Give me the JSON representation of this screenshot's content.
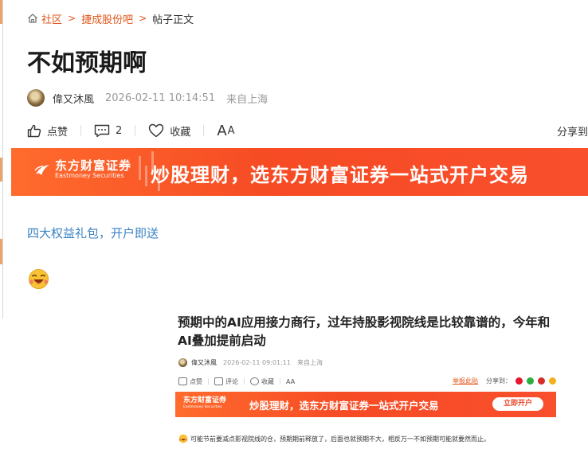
{
  "breadcrumb": {
    "home": "社区",
    "forum": "捷成股份吧",
    "current": "帖子正文",
    "separator": ">"
  },
  "post": {
    "title": "不如预期啊",
    "author": "偉又沐風",
    "time": "2026-02-11 10:14:51",
    "location": "来自上海"
  },
  "actions": {
    "like": "点赞",
    "comment_count": "2",
    "favorite": "收藏",
    "font_size_large": "A",
    "font_size_small": "A",
    "share": "分享到"
  },
  "banner": {
    "logo_cn": "东方财富证券",
    "logo_en": "Eastmoney Securities",
    "slogan": "炒股理财，选东方财富证券一站式开户交易"
  },
  "promo_link": "四大权益礼包，开户即送",
  "embedded": {
    "title": "预期中的AI应用接力商行，过年持股影视院线是比较靠谱的，今年和AI叠加提前启动",
    "author": "偉又沐風",
    "time": "2026-02-11 09:01:11",
    "location": "来自上海",
    "like": "点赞",
    "comment": "评论",
    "favorite": "收藏",
    "font": "AA",
    "report": "举报此贴",
    "share": "分享到：",
    "banner_logo_cn": "东方财富证券",
    "banner_logo_en": "Eastmoney Securities",
    "banner_slogan": "炒股理财，选东方财富证券一站式开户交易",
    "banner_button": "立即开户",
    "body": "可能节前要减点影视院线的仓，预期期前释放了，后面也就预期不大，相反万一不如预期可能就要然而止。"
  },
  "colors": {
    "accent": "#e0561a",
    "link": "#3a82c4",
    "banner": "#f64b24"
  }
}
